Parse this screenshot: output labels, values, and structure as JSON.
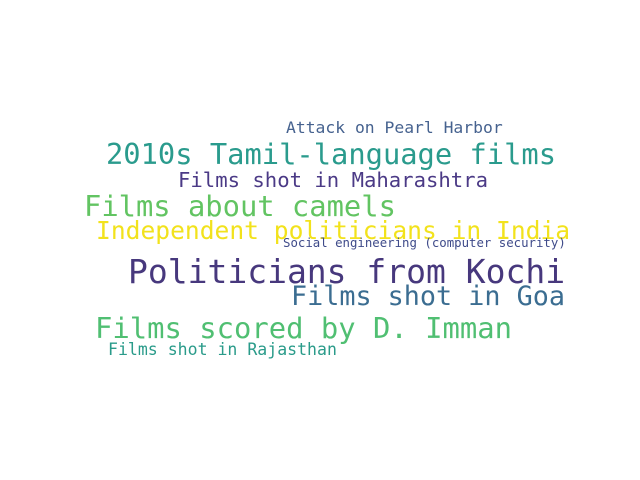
{
  "words": [
    {
      "text": "Attack on Pearl Harbor",
      "color": "#46628f"
    },
    {
      "text": "2010s Tamil-language films",
      "color": "#2a9b8d"
    },
    {
      "text": "Films shot in Maharashtra",
      "color": "#4b3a86"
    },
    {
      "text": "Films about camels",
      "color": "#62c462"
    },
    {
      "text": "Independent politicians in India",
      "color": "#f2e21c"
    },
    {
      "text": "Social engineering (computer security)",
      "color": "#3f4b8a"
    },
    {
      "text": "Politicians from Kochi",
      "color": "#47387d"
    },
    {
      "text": "Films shot in Goa",
      "color": "#3b6d91"
    },
    {
      "text": "Films scored by D. Imman",
      "color": "#50bf72"
    },
    {
      "text": "Films shot in Rajasthan",
      "color": "#2a9b8a"
    }
  ]
}
